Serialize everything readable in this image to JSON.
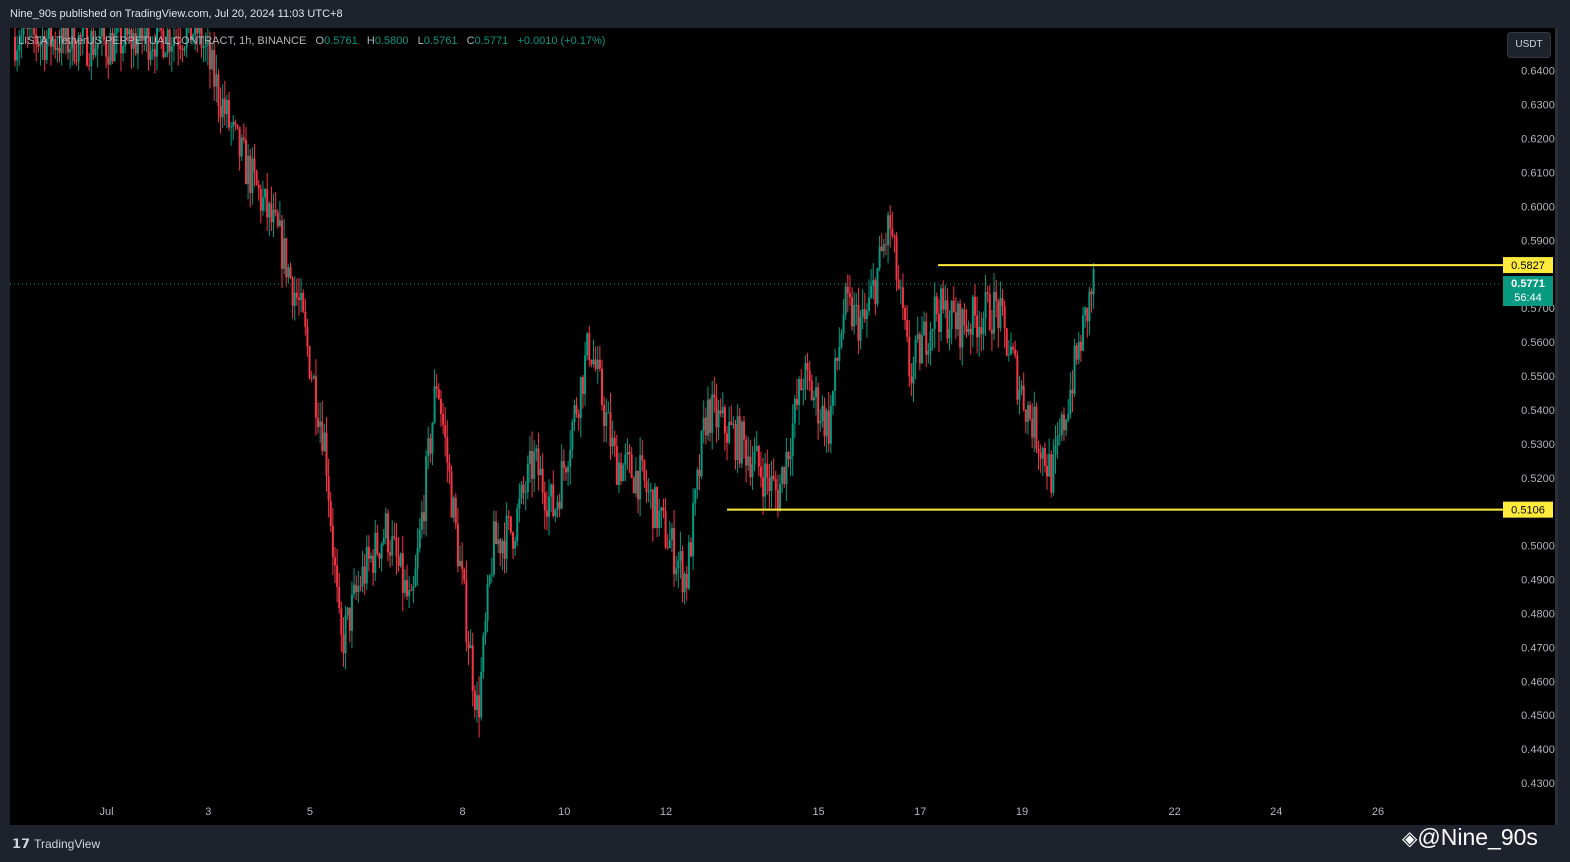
{
  "header": {
    "published": "Nine_90s published on TradingView.com, Jul 20, 2024 11:03 UTC+8"
  },
  "legend": {
    "symbol": "LISTA / TetherUS PERPETUAL CONTRACT, 1h, BINANCE",
    "o_label": "O",
    "o": "0.5761",
    "h_label": "H",
    "h": "0.5800",
    "l_label": "L",
    "l": "0.5761",
    "c_label": "C",
    "c": "0.5771",
    "change": "+0.0010 (+0.17%)"
  },
  "currency_button": "USDT",
  "footer": {
    "brand": "TradingView",
    "brand_logo": "17",
    "handle": "@Nine_90s"
  },
  "colors": {
    "up": "#089981",
    "down": "#f23645",
    "level": "#ffeb3b",
    "background": "#000000"
  },
  "chart_data": {
    "type": "candlestick",
    "timeframe": "1h",
    "ylim": [
      0.425,
      0.652
    ],
    "y_ticks": [
      "0.6400",
      "0.6300",
      "0.6200",
      "0.6100",
      "0.6000",
      "0.5900",
      "0.5700",
      "0.5600",
      "0.5500",
      "0.5400",
      "0.5300",
      "0.5200",
      "0.5000",
      "0.4900",
      "0.4800",
      "0.4700",
      "0.4600",
      "0.4500",
      "0.4400",
      "0.4300"
    ],
    "x_ticks": [
      {
        "label": "Jul",
        "day": 1
      },
      {
        "label": "3",
        "day": 3
      },
      {
        "label": "5",
        "day": 5
      },
      {
        "label": "8",
        "day": 8
      },
      {
        "label": "10",
        "day": 10
      },
      {
        "label": "12",
        "day": 12
      },
      {
        "label": "15",
        "day": 15
      },
      {
        "label": "17",
        "day": 17
      },
      {
        "label": "19",
        "day": 19
      },
      {
        "label": "22",
        "day": 22
      },
      {
        "label": "24",
        "day": 24
      },
      {
        "label": "26",
        "day": 26
      }
    ],
    "xlim_days": [
      -0.8,
      28.3
    ],
    "approx_close_path": [
      [
        -0.8,
        0.65
      ],
      [
        1,
        0.648
      ],
      [
        2.8,
        0.652
      ],
      [
        3.5,
        0.62
      ],
      [
        4.4,
        0.59
      ],
      [
        4.8,
        0.57
      ],
      [
        5.3,
        0.53
      ],
      [
        5.6,
        0.47
      ],
      [
        6,
        0.49
      ],
      [
        6.5,
        0.505
      ],
      [
        7,
        0.48
      ],
      [
        7.5,
        0.55
      ],
      [
        7.9,
        0.5
      ],
      [
        8.3,
        0.45
      ],
      [
        8.6,
        0.5
      ],
      [
        9,
        0.505
      ],
      [
        9.4,
        0.525
      ],
      [
        9.8,
        0.51
      ],
      [
        10.5,
        0.56
      ],
      [
        11,
        0.525
      ],
      [
        11.5,
        0.52
      ],
      [
        12.4,
        0.49
      ],
      [
        12.8,
        0.54
      ],
      [
        13.5,
        0.53
      ],
      [
        14.2,
        0.515
      ],
      [
        14.7,
        0.55
      ],
      [
        15.2,
        0.535
      ],
      [
        15.5,
        0.57
      ],
      [
        15.9,
        0.565
      ],
      [
        16.4,
        0.595
      ],
      [
        16.8,
        0.55
      ],
      [
        17.3,
        0.57
      ],
      [
        17.8,
        0.565
      ],
      [
        18.5,
        0.57
      ],
      [
        19.0,
        0.545
      ],
      [
        19.6,
        0.52
      ],
      [
        20.0,
        0.55
      ],
      [
        20.4,
        0.5771
      ]
    ],
    "levels": [
      {
        "price": 0.5827,
        "label": "0.5827",
        "from_day": 17.35
      },
      {
        "price": 0.5106,
        "label": "0.5106",
        "from_day": 13.2
      }
    ],
    "last_price": {
      "price": 0.5771,
      "label": "0.5771",
      "countdown": "56:44"
    }
  }
}
